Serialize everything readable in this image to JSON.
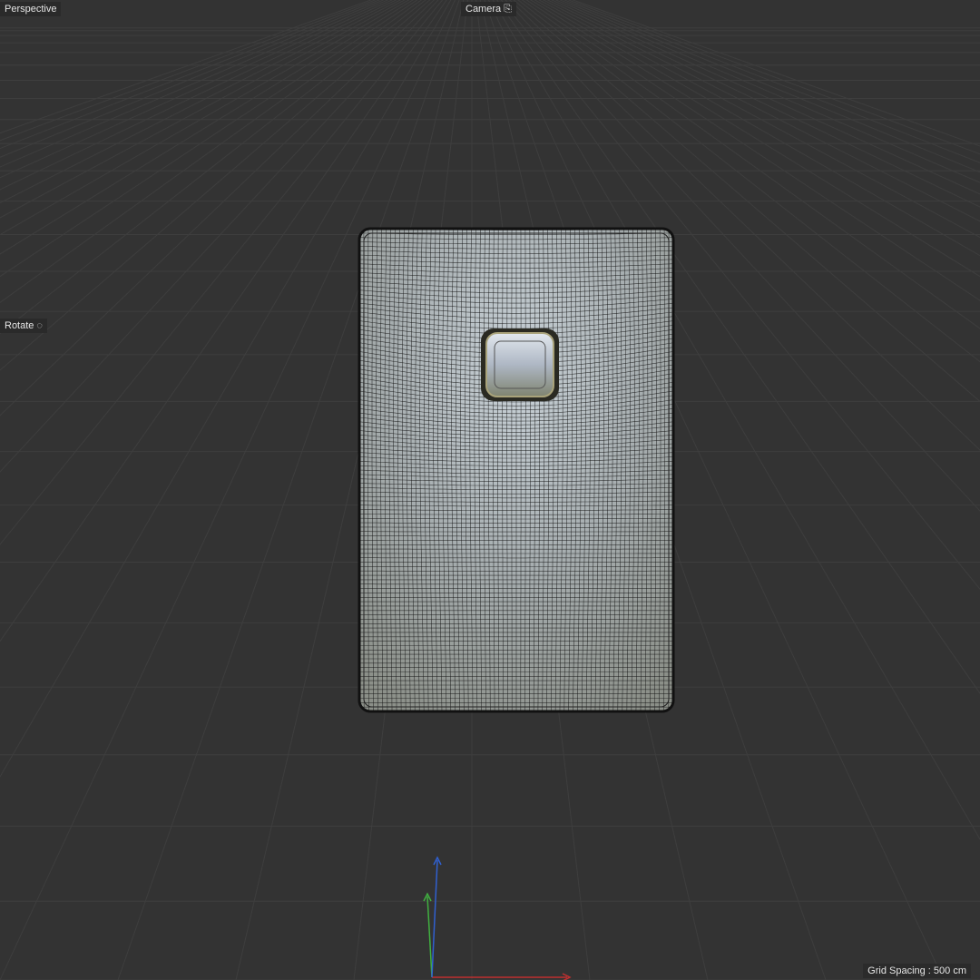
{
  "viewport": {
    "view_name": "Perspective",
    "camera_label": "Camera",
    "camera_icon": "camera-icon",
    "mode_label": "Rotate",
    "mode_icon": "rotate-icon",
    "grid_spacing": "Grid Spacing : 500 cm"
  },
  "colors": {
    "background": "#333333",
    "grid_line": "#3e3e3e",
    "axis_x": "#c03030",
    "axis_y": "#40b040",
    "axis_z": "#3060d0",
    "wire": "#111111",
    "mesh_fill": "#9aa0a2"
  }
}
